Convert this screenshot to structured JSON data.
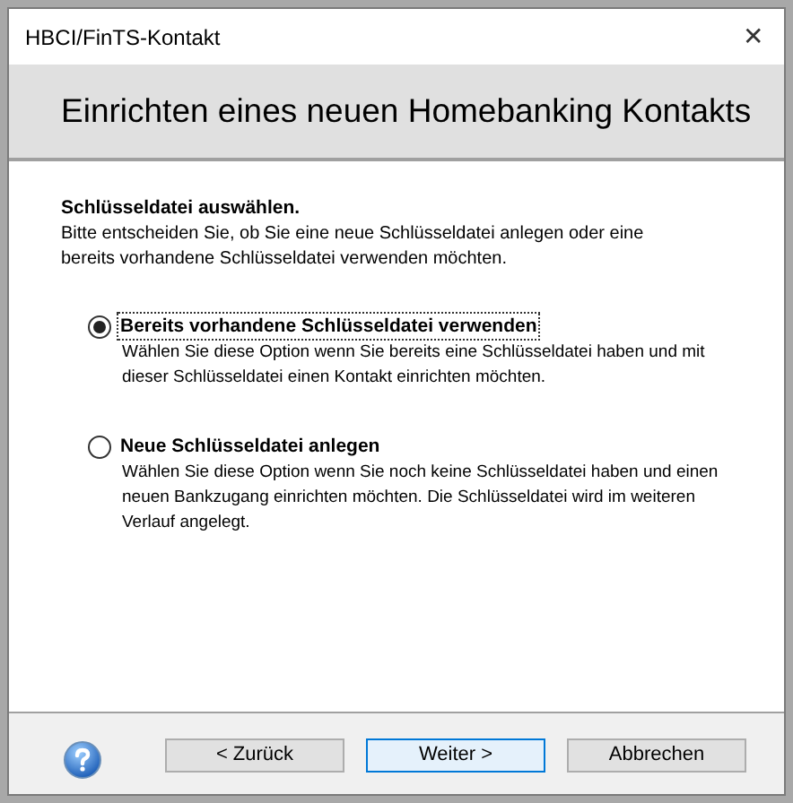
{
  "window": {
    "title": "HBCI/FinTS-Kontakt",
    "close": "✕"
  },
  "header": {
    "title": "Einrichten eines neuen Homebanking Kontakts"
  },
  "section": {
    "heading": "Schlüsseldatei auswählen.",
    "text": "Bitte entscheiden Sie, ob Sie eine neue Schlüsseldatei anlegen oder eine bereits vorhandene Schlüsseldatei verwenden möchten."
  },
  "options": [
    {
      "label": "Bereits vorhandene Schlüsseldatei verwenden",
      "description": "Wählen Sie diese Option wenn Sie bereits eine Schlüsseldatei haben und mit dieser Schlüsseldatei einen Kontakt einrichten möchten.",
      "selected": true,
      "focused": true
    },
    {
      "label": "Neue Schlüsseldatei anlegen",
      "description": "Wählen Sie diese Option wenn Sie noch keine Schlüsseldatei haben und einen neuen Bankzugang einrichten möchten. Die Schlüsseldatei wird im weiteren Verlauf angelegt.",
      "selected": false,
      "focused": false
    }
  ],
  "buttons": [
    {
      "label": "< Zurück",
      "focused": false
    },
    {
      "label": "Weiter >",
      "focused": true
    },
    {
      "label": "Abbrechen",
      "focused": false
    }
  ]
}
